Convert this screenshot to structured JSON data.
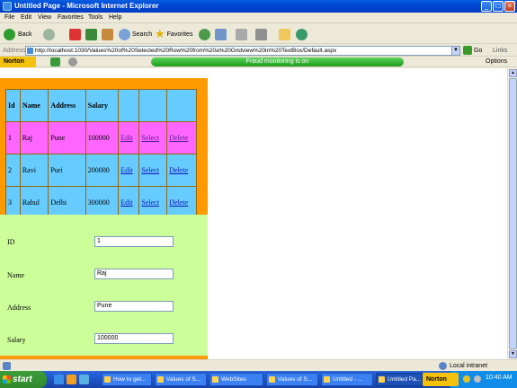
{
  "window": {
    "title": "Untitled Page - Microsoft Internet Explorer"
  },
  "menu": [
    "File",
    "Edit",
    "View",
    "Favorites",
    "Tools",
    "Help"
  ],
  "toolbar": {
    "back": "Back",
    "search": "Search",
    "favorites": "Favorites"
  },
  "address": {
    "label": "Address",
    "url": "http://localhost:1030/Values%20of%20Selected%20Row%20from%20a%20Gridview%20in%20TextBox/Default.aspx",
    "go": "Go",
    "links": "Links"
  },
  "norton": {
    "logo": "Norton",
    "fraud_status": "Fraud monitoring is on",
    "options": "Options"
  },
  "grid": {
    "headers": [
      "Id",
      "Name",
      "Address",
      "Salary",
      "",
      "",
      ""
    ],
    "rows": [
      {
        "id": "1",
        "name": "Raj",
        "address": "Pune",
        "salary": "100000",
        "edit": "Edit",
        "select": "Select",
        "delete": "Delete"
      },
      {
        "id": "2",
        "name": "Ravi",
        "address": "Puri",
        "salary": "200000",
        "edit": "Edit",
        "select": "Select",
        "delete": "Delete"
      },
      {
        "id": "3",
        "name": "Rahul",
        "address": "Delhi",
        "salary": "300000",
        "edit": "Edit",
        "select": "Select",
        "delete": "Delete"
      }
    ],
    "selected_row": 0,
    "colors": {
      "header": "#66ccff",
      "row": "#66ccff",
      "selected": "#ff66ff",
      "panel": "#ff9900"
    }
  },
  "form": {
    "fields": [
      {
        "label": "ID",
        "value": "1"
      },
      {
        "label": "Name",
        "value": "Raj"
      },
      {
        "label": "Address",
        "value": "Pune"
      },
      {
        "label": "Salary",
        "value": "100000"
      }
    ],
    "panel_color": "#ccff99"
  },
  "status": {
    "zone": "Local intranet"
  },
  "taskbar": {
    "start": "start",
    "tasks": [
      "How to get...",
      "Values of S...",
      "WebSites",
      "Values of S...",
      "Untitled - ...",
      "Untitled Pa..."
    ],
    "active_task": 5,
    "norton": "Norton",
    "clock": "10:40 AM"
  }
}
